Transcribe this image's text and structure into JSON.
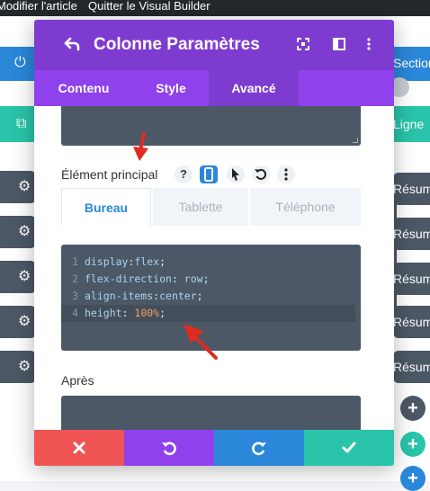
{
  "topbar": {
    "edit_label": "Modifier l'article",
    "quit_label": "Quitter le Visual Builder"
  },
  "background": {
    "section_label": "Section",
    "row_label": "Ligne",
    "module_labels": [
      "Résumé",
      "Résumé",
      "Résumé",
      "Résumé",
      "Résumé"
    ]
  },
  "modal": {
    "title": "Colonne Paramètres",
    "tabs": [
      {
        "label": "Contenu",
        "active": false
      },
      {
        "label": "Style",
        "active": false
      },
      {
        "label": "Avancé",
        "active": true
      }
    ],
    "main_element_label": "Élément principal",
    "help_glyph": "?",
    "device_tabs": [
      {
        "label": "Bureau",
        "active": true
      },
      {
        "label": "Tablette",
        "active": false
      },
      {
        "label": "Téléphone",
        "active": false
      }
    ],
    "code_lines": [
      {
        "num": "1",
        "prop": "display",
        "sep": ":",
        "value": "flex",
        "end": ";"
      },
      {
        "num": "2",
        "prop": "flex-direction",
        "sep": ": ",
        "value": "row",
        "end": ";"
      },
      {
        "num": "3",
        "prop": "align-items",
        "sep": ":",
        "value": "center",
        "end": ";"
      },
      {
        "num": "4",
        "prop": "height",
        "sep": ": ",
        "value": "100%",
        "end": ";"
      }
    ],
    "after_label": "Après"
  },
  "colors": {
    "purple_header": "#7e3bd0",
    "purple_tabs": "#8f42ec",
    "cancel": "#ef5555",
    "undo": "#8f42ec",
    "redo": "#2b87da",
    "save": "#29c4a9",
    "section_blue": "#2b87da",
    "row_teal": "#29c4a9",
    "arrow_red": "#e02b20"
  },
  "icons": {
    "back": "back-arrow-icon",
    "expand": "fullscreen-icon",
    "columns": "sidebar-layout-icon",
    "more": "vertical-dots-icon",
    "device": "phone-icon",
    "hover": "cursor-icon",
    "reset": "reset-icon",
    "cancel": "close-icon",
    "undo": "undo-icon",
    "redo": "redo-icon",
    "save": "check-icon"
  }
}
